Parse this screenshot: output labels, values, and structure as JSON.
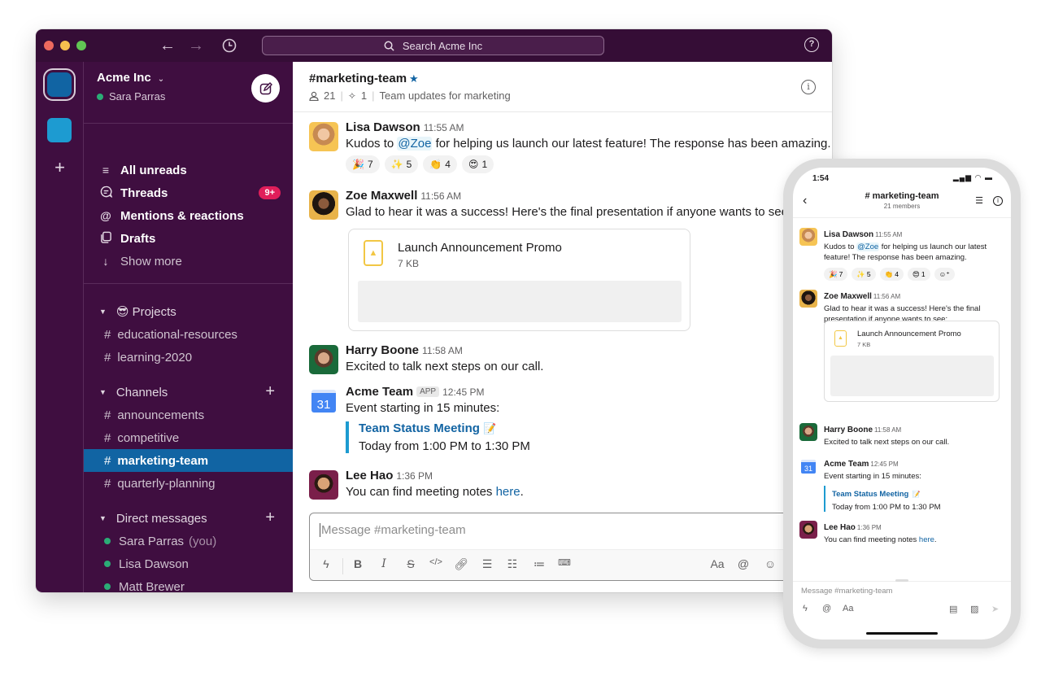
{
  "desktop": {
    "search_placeholder": "Search Acme Inc",
    "workspace": {
      "name": "Acme Inc",
      "user": "Sara Parras"
    },
    "nav": [
      {
        "label": "All unreads",
        "icon": "unreads-icon"
      },
      {
        "label": "Threads",
        "icon": "threads-icon",
        "badge": "9+"
      },
      {
        "label": "Mentions & reactions",
        "icon": "at-icon"
      },
      {
        "label": "Drafts",
        "icon": "drafts-icon"
      },
      {
        "label": "Show more",
        "icon": "arrow-down-icon"
      }
    ],
    "sections": {
      "projects": {
        "title": "Projects",
        "emoji": "😎",
        "channels": [
          "educational-resources",
          "learning-2020"
        ]
      },
      "channels": {
        "title": "Channels",
        "channels": [
          "announcements",
          "competitive",
          "marketing-team",
          "quarterly-planning"
        ],
        "active": "marketing-team"
      },
      "dms": {
        "title": "Direct messages",
        "people": [
          "Sara Parras",
          "Lisa Dawson",
          "Matt Brewer"
        ],
        "you_suffix": "(you)"
      }
    },
    "channel": {
      "name": "#marketing-team",
      "members": "21",
      "pinned": "1",
      "topic": "Team updates for marketing"
    },
    "messages": [
      {
        "author": "Lisa Dawson",
        "time": "11:55 AM",
        "pre": "Kudos to ",
        "mention": "@Zoe",
        "post": " for helping us launch our latest feature! The response has been amazing.",
        "reactions": [
          {
            "emoji": "🎉",
            "count": "7"
          },
          {
            "emoji": "✨",
            "count": "5"
          },
          {
            "emoji": "👏",
            "count": "4"
          },
          {
            "emoji": "😍",
            "count": "1"
          }
        ]
      },
      {
        "author": "Zoe Maxwell",
        "time": "11:56 AM",
        "text": "Glad to hear it was a success! Here's the final presentation if anyone wants to see:",
        "file": {
          "name": "Launch Announcement Promo",
          "size": "7 KB"
        }
      },
      {
        "author": "Harry Boone",
        "time": "11:58 AM",
        "text": "Excited to talk next steps on our call."
      },
      {
        "author": "Acme Team",
        "app_tag": "APP",
        "time": "12:45 PM",
        "text": "Event starting in 15 minutes:",
        "calendar_day": "31",
        "event": {
          "title": "Team Status Meeting",
          "emoji": "📝",
          "when": "Today from 1:00 PM to 1:30 PM"
        }
      },
      {
        "author": "Lee Hao",
        "time": "1:36 PM",
        "pre": "You can find meeting notes ",
        "link": "here",
        "post": "."
      }
    ],
    "composer_placeholder": "Message #marketing-team",
    "toolbar": {
      "format_label": "Aa"
    }
  },
  "mobile": {
    "clock": "1:54",
    "channel": "# marketing-team",
    "members": "21 members",
    "messages": {
      "lisa_line1_pre": "Kudos to ",
      "lisa_mention": "@Zoe",
      "lisa_line1_post": " for helping us launch our latest",
      "lisa_line2": "feature! The response has been amazing.",
      "zoe_line1": "Glad to hear it was a success! Here's the final",
      "zoe_line2": "presentation if anyone wants to see:"
    },
    "composer_placeholder": "Message #marketing-team",
    "format_label": "Aa"
  }
}
